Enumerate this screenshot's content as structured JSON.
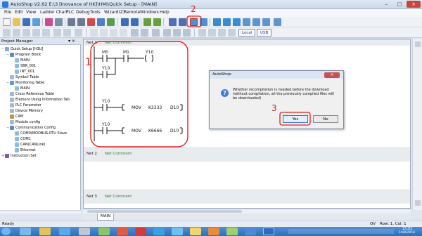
{
  "window": {
    "title": "AutoShop V2.62  E:\\3 [Inovance of HK]\\HMI\\Quick Setup - [MAIN]",
    "controls": [
      "–",
      "□",
      "×"
    ]
  },
  "menu": [
    "File",
    "Edit",
    "View",
    "Ladder Chart",
    "PLC",
    "Debug",
    "Tools",
    "Wizard(Z)",
    "Remote",
    "Windows",
    "Help"
  ],
  "toolbar2": {
    "local_label": "Local",
    "usb_label": "USB"
  },
  "project_manager": {
    "title": "Project Manager",
    "pin": "▾ ×",
    "tree": [
      {
        "label": "Quick Setup [H3U]",
        "level": 0,
        "expander": "−"
      },
      {
        "label": "Program Block",
        "level": 1,
        "expander": "−"
      },
      {
        "label": "MAIN",
        "level": 2,
        "expander": ""
      },
      {
        "label": "SBR_001",
        "level": 2,
        "expander": ""
      },
      {
        "label": "INT_001",
        "level": 2,
        "expander": ""
      },
      {
        "label": "Symbol Table",
        "level": 1,
        "expander": ""
      },
      {
        "label": "Monitoring Table",
        "level": 1,
        "expander": "−"
      },
      {
        "label": "MAIN",
        "level": 2,
        "expander": ""
      },
      {
        "label": "Cross Reference Table",
        "level": 1,
        "expander": ""
      },
      {
        "label": "Element Using Information Tab",
        "level": 1,
        "expander": ""
      },
      {
        "label": "PLC Parameter",
        "level": 1,
        "expander": ""
      },
      {
        "label": "Device Memory",
        "level": 1,
        "expander": ""
      },
      {
        "label": "CAM",
        "level": 1,
        "expander": ""
      },
      {
        "label": "Module config",
        "level": 1,
        "expander": ""
      },
      {
        "label": "Communication Config",
        "level": 1,
        "expander": "−"
      },
      {
        "label": "COM0(MODBUS-RTU Slave",
        "level": 2,
        "expander": ""
      },
      {
        "label": "COM1",
        "level": 2,
        "expander": ""
      },
      {
        "label": "CAN(CANLink)",
        "level": 2,
        "expander": ""
      },
      {
        "label": "Ethernet",
        "level": 2,
        "expander": ""
      },
      {
        "label": "Instruction Set",
        "level": 0,
        "expander": "+"
      }
    ]
  },
  "networks": [
    {
      "label": "Net 1",
      "comment": "Net Comment"
    },
    {
      "label": "Net 2",
      "comment": "Net Comment"
    },
    {
      "label": "Net 3",
      "comment": "Net Comment"
    }
  ],
  "ladder": {
    "contact1": "M0",
    "contact2": "M1",
    "coil": "Y10",
    "parallel": "Y10",
    "branch2": "Y10",
    "mov1": {
      "op": "MOV",
      "src": "K3333",
      "dst": "D10"
    },
    "branch3": "Y10",
    "mov2": {
      "op": "MOV",
      "src": "K6666",
      "dst": "D10"
    }
  },
  "annotations": [
    "1",
    "2",
    "3"
  ],
  "dialog": {
    "title": "AutoShop",
    "close": "×",
    "icon": "?",
    "message": "Whether recompilation is needed before the download (without compilation, all the previously compiled files will be downloaded)",
    "yes": "Yes",
    "no": "No"
  },
  "tabs": {
    "active": "MAIN"
  },
  "status": {
    "left": "Ready",
    "mode": "OV",
    "position": "Row: 1, Col: 1"
  },
  "taskbar": {
    "time": "15:02",
    "date": "10/8/2016"
  },
  "colors": {
    "annotation": "#e02020",
    "comment": "#2f7a2f",
    "accent": "#2b7bd6"
  }
}
